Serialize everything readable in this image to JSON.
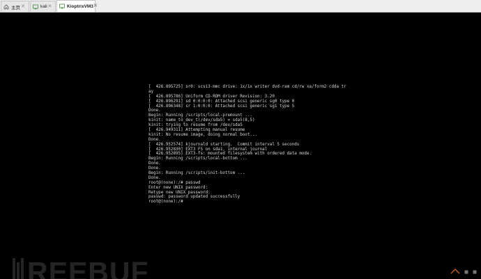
{
  "tabs": [
    {
      "label": "主页",
      "icon": "home-icon",
      "active": false
    },
    {
      "label": "kali",
      "icon": "vm-icon",
      "active": false
    },
    {
      "label": "KioptrixVM3",
      "icon": "vm-icon",
      "active": true
    }
  ],
  "console": {
    "lines": [
      "[  426.895725] sr0: scsi3-mmc drive: 1x/1x writer dvd-ram cd/rw xa/form2 cdda tr",
      "ay",
      "[  426.895786] Uniform CD-ROM driver Revision: 3.20",
      "[  426.896291] sd 0:0:0:0: Attached scsi generic sg0 type 0",
      "[  426.896348] sr 1:0:0:0: Attached scsi generic sg1 type 5",
      "Done.",
      "Begin: Running /scripts/local-premount ...",
      "kinit: name_to_dev_t(/dev/sda5) = sda5(8,5)",
      "kinit: trying to resume from /dev/sda5",
      "[  426.949311] Attempting manual resume",
      "kinit: No resume image, doing normal boot...",
      "Done.",
      "[  426.952574] kjournald starting.  Commit interval 5 seconds",
      "[  426.952830] EXT3 FS on sda1, internal journal",
      "[  426.952895] EXT3-fs: mounted filesystem with ordered data mode.",
      "Begin: Running /scripts/local-bottom ...",
      "Done.",
      "Done.",
      "Begin: Running /scripts/init-bottom ...",
      "Done.",
      "root@(none):/# passwd",
      "Enter new UNIX password:",
      "Retype new UNIX password:",
      "passwd: password updated successfully",
      "root@(none):/#"
    ]
  },
  "watermark": {
    "text": "REEBUF"
  },
  "colors": {
    "accent": "#2e8b57",
    "terminal_text": "#d8d8d8",
    "background": "#000000"
  }
}
